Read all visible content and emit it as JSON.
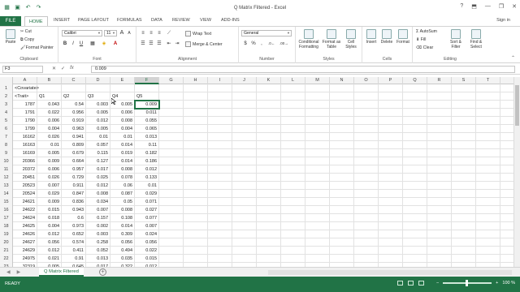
{
  "window": {
    "title": "Q Matrix Filtered - Excel",
    "help": "?",
    "minimize": "—",
    "restore": "❐",
    "close": "✕",
    "sign_in": "Sign in"
  },
  "ribbon_tabs": [
    {
      "label": "FILE"
    },
    {
      "label": "HOME"
    },
    {
      "label": "INSERT"
    },
    {
      "label": "PAGE LAYOUT"
    },
    {
      "label": "FORMULAS"
    },
    {
      "label": "DATA"
    },
    {
      "label": "REVIEW"
    },
    {
      "label": "VIEW"
    },
    {
      "label": "ADD-INS"
    }
  ],
  "clipboard": {
    "paste": "Paste",
    "cut": "Cut",
    "copy": "Copy",
    "format_painter": "Format Painter",
    "label": "Clipboard"
  },
  "font": {
    "name": "Calibri",
    "size": "11",
    "label": "Font",
    "bold": "B",
    "italic": "I",
    "underline": "U"
  },
  "alignment": {
    "wrap_text": "Wrap Text",
    "merge_center": "Merge & Center",
    "label": "Alignment"
  },
  "number": {
    "format": "General",
    "currency": "$",
    "percent": "%",
    "comma": ",",
    "label": "Number"
  },
  "styles": {
    "conditional": "Conditional Formatting",
    "format_as_table": "Format as Table",
    "cell_styles": "Cell Styles",
    "label": "Styles"
  },
  "cells": {
    "insert": "Insert",
    "delete": "Delete",
    "format": "Format",
    "label": "Cells"
  },
  "editing": {
    "autosum": "AutoSum",
    "fill": "Fill",
    "clear": "Clear",
    "sort_filter": "Sort & Filter",
    "find_select": "Find & Select",
    "label": "Editing"
  },
  "formula_bar": {
    "name_box": "F3",
    "cancel": "✕",
    "enter": "✓",
    "fx": "fx",
    "value": "0.009"
  },
  "columns": [
    "A",
    "B",
    "C",
    "D",
    "E",
    "F",
    "G",
    "H",
    "I",
    "J",
    "K",
    "L",
    "M",
    "N",
    "O",
    "P",
    "Q",
    "R",
    "S",
    "T"
  ],
  "selected_column": "F",
  "rows": [
    {
      "n": "1",
      "cells": [
        "<Covariate>",
        "",
        "",
        "",
        "",
        ""
      ]
    },
    {
      "n": "2",
      "cells": [
        "<Trait>",
        "Q1",
        "Q2",
        "Q3",
        "Q4",
        "Q5"
      ]
    },
    {
      "n": "3",
      "cells": [
        "1787",
        "0.043",
        "0.54",
        "0.003",
        "0.005",
        "0.009"
      ]
    },
    {
      "n": "4",
      "cells": [
        "1791",
        "0.022",
        "0.956",
        "0.005",
        "0.006",
        "0.011"
      ]
    },
    {
      "n": "5",
      "cells": [
        "1790",
        "0.006",
        "0.919",
        "0.012",
        "0.008",
        "0.055"
      ]
    },
    {
      "n": "6",
      "cells": [
        "1799",
        "0.004",
        "0.963",
        "0.005",
        "0.004",
        "0.065"
      ]
    },
    {
      "n": "7",
      "cells": [
        "16162",
        "0.026",
        "0.941",
        "0.01",
        "0.01",
        "0.013"
      ]
    },
    {
      "n": "8",
      "cells": [
        "16163",
        "0.01",
        "0.809",
        "0.057",
        "0.014",
        "0.11"
      ]
    },
    {
      "n": "9",
      "cells": [
        "16169",
        "0.005",
        "0.679",
        "0.115",
        "0.019",
        "0.182"
      ]
    },
    {
      "n": "10",
      "cells": [
        "20366",
        "0.009",
        "0.664",
        "0.127",
        "0.014",
        "0.186"
      ]
    },
    {
      "n": "11",
      "cells": [
        "20372",
        "0.006",
        "0.957",
        "0.017",
        "0.008",
        "0.012"
      ]
    },
    {
      "n": "12",
      "cells": [
        "20451",
        "0.026",
        "0.729",
        "0.025",
        "0.078",
        "0.133"
      ]
    },
    {
      "n": "13",
      "cells": [
        "20523",
        "0.007",
        "0.911",
        "0.012",
        "0.06",
        "0.01"
      ]
    },
    {
      "n": "14",
      "cells": [
        "20524",
        "0.029",
        "0.847",
        "0.008",
        "0.087",
        "0.029"
      ]
    },
    {
      "n": "15",
      "cells": [
        "24621",
        "0.009",
        "0.836",
        "0.034",
        "0.05",
        "0.071"
      ]
    },
    {
      "n": "16",
      "cells": [
        "24622",
        "0.015",
        "0.943",
        "0.007",
        "0.008",
        "0.027"
      ]
    },
    {
      "n": "17",
      "cells": [
        "24624",
        "0.018",
        "0.6",
        "0.157",
        "0.108",
        "0.077"
      ]
    },
    {
      "n": "18",
      "cells": [
        "24625",
        "0.004",
        "0.973",
        "0.002",
        "0.014",
        "0.007"
      ]
    },
    {
      "n": "19",
      "cells": [
        "24626",
        "0.012",
        "0.652",
        "0.003",
        "0.309",
        "0.024"
      ]
    },
    {
      "n": "20",
      "cells": [
        "24627",
        "0.056",
        "0.574",
        "0.258",
        "0.056",
        "0.056"
      ]
    },
    {
      "n": "21",
      "cells": [
        "24629",
        "0.012",
        "0.411",
        "0.052",
        "0.494",
        "0.022"
      ]
    },
    {
      "n": "22",
      "cells": [
        "24975",
        "0.021",
        "0.91",
        "0.013",
        "0.035",
        "0.015"
      ]
    },
    {
      "n": "23",
      "cells": [
        "32319",
        "0.005",
        "0.645",
        "0.017",
        "0.322",
        "0.012"
      ]
    }
  ],
  "sheet": {
    "tab": "Q Matrix Filtered",
    "add": "+"
  },
  "status": {
    "ready": "READY",
    "zoom": "100 %",
    "zoom_out": "−",
    "zoom_in": "+"
  }
}
